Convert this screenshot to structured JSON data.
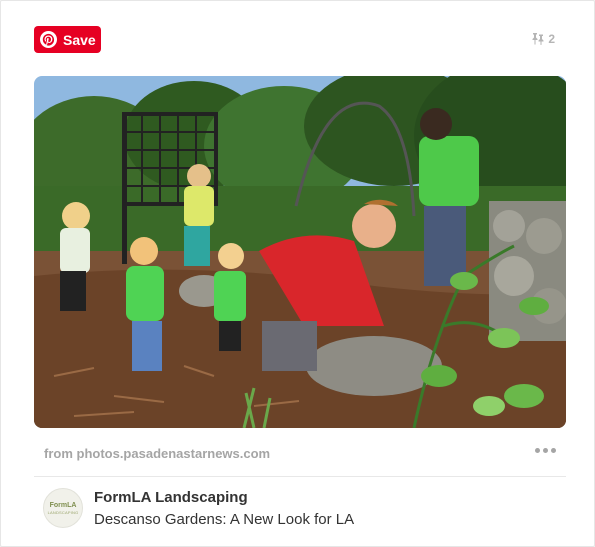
{
  "save_button": {
    "label": "Save"
  },
  "pin_count": "2",
  "image": {
    "alt": "Children playing in the Descanso Gardens landscaped garden"
  },
  "source": "from photos.pasadenastarnews.com",
  "avatar": {
    "line1": "FormLA",
    "line2": "LANDSCAPING"
  },
  "author": "FormLA Landscaping",
  "title": "Descanso Gardens: A New Look for LA",
  "colors": {
    "save_red": "#e60023",
    "muted": "#a5a5a5",
    "text": "#333333"
  },
  "icons": [
    "pinterest-logo-icon",
    "pin-count-icon",
    "more-options-icon"
  ]
}
